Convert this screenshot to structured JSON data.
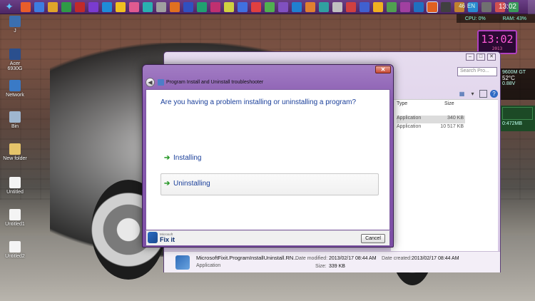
{
  "taskbar": {
    "clock": "13:02",
    "tray_text_1": "46",
    "tray_text_2": "EN",
    "icon_colors": [
      "#e85d2a",
      "#3d7de0",
      "#e0a52a",
      "#2f9a46",
      "#c02a2a",
      "#7a3bd0",
      "#1e8bd8",
      "#f0c020",
      "#e05a90",
      "#2ab0b0",
      "#a0a0a0",
      "#e07020",
      "#3050c0",
      "#20a070",
      "#c03070",
      "#d0d040",
      "#4070e0",
      "#e04040",
      "#50b050",
      "#8050c0",
      "#2080d0",
      "#e08030",
      "#30a0a0",
      "#c0c0c0",
      "#d04040",
      "#4060d0",
      "#f0b020",
      "#50a050",
      "#a040a0",
      "#2070c0",
      "#e06020",
      "#404040",
      "#c08030",
      "#2a8ad0",
      "#707070",
      "#d05050",
      "#3a9a5a"
    ]
  },
  "desktop_icons": [
    {
      "label": "J"
    },
    {
      "label": "Acer 6930G"
    },
    {
      "label": "Network"
    },
    {
      "label": "Bin"
    },
    {
      "label": "New folder"
    },
    {
      "label": "Untitled"
    },
    {
      "label": "Untitled1"
    },
    {
      "label": "Untitled2"
    }
  ],
  "gadgets": {
    "cpu": "CPU: 0%",
    "ram": "RAM: 43%",
    "clock": "13:02",
    "clock_date": "2013",
    "gpu_name": "9600M GT",
    "gpu_temp": "52°C",
    "gpu_voltage": "0.88V",
    "mem": "0:472MB"
  },
  "explorer": {
    "search_placeholder": "Search Pro...",
    "columns": {
      "type": "Type",
      "size": "Size"
    },
    "rows": [
      {
        "type": "Application",
        "size": "340 KB"
      },
      {
        "type": "Application",
        "size": "10 517 KB"
      }
    ],
    "details": {
      "filename": "MicrosoftFixit.ProgramInstallUninstall.RN...",
      "filetype": "Application",
      "modified_label": "Date modified:",
      "modified_value": "2013/02/17 08:44 AM",
      "created_label": "Date created:",
      "created_value": "2013/02/17 08:44 AM",
      "size_label": "Size:",
      "size_value": "339 KB"
    }
  },
  "dialog": {
    "title": "Program Install and Uninstall troubleshooter",
    "question": "Are you having a problem installing or uninstalling a program?",
    "choices": [
      {
        "label": "Installing"
      },
      {
        "label": "Uninstalling"
      }
    ],
    "brand_small": "Microsoft",
    "brand_name": "Fix it",
    "cancel": "Cancel"
  }
}
